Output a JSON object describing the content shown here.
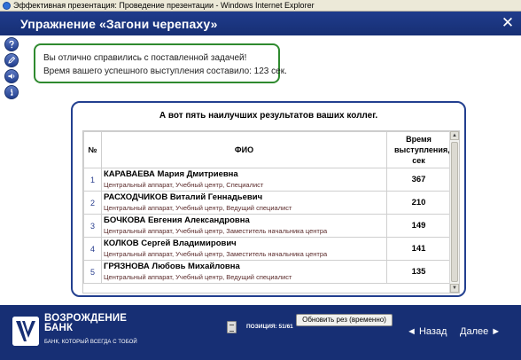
{
  "window": {
    "title": "Эффективная презентация: Проведение презентации - Windows Internet Explorer"
  },
  "header": {
    "title": "Упражнение «Загони черепаху»",
    "close_label": "✕"
  },
  "toolbar": {
    "icons": [
      "help-icon",
      "edit-icon",
      "audio-icon",
      "info-icon"
    ]
  },
  "message": {
    "line1": "Вы отлично справились с поставленной задачей!",
    "line2": "Время вашего успешного выступления составило: 123 сек."
  },
  "results": {
    "title": "А вот пять наилучших результатов ваших коллег.",
    "columns": {
      "num": "№",
      "name": "ФИО",
      "time": "Время выступления, сек"
    },
    "rows": [
      {
        "num": "1",
        "name": "КАРАВАЕВА Мария Дмитриевна",
        "dept": "Центральный аппарат, Учебный центр, Специалист",
        "time": "367"
      },
      {
        "num": "2",
        "name": "РАСХОДЧИКОВ Виталий Геннадьевич",
        "dept": "Центральный аппарат, Учебный центр, Ведущий специалист",
        "time": "210"
      },
      {
        "num": "3",
        "name": "БОЧКОВА Евгения Александровна",
        "dept": "Центральный аппарат, Учебный центр, Заместитель начальника центра",
        "time": "149"
      },
      {
        "num": "4",
        "name": "КОЛКОВ Сергей Владимирович",
        "dept": "Центральный аппарат, Учебный центр, Заместитель начальника центра",
        "time": "141"
      },
      {
        "num": "5",
        "name": "ГРЯЗНОВА Любовь Михайловна",
        "dept": "Центральный аппарат, Учебный центр, Ведущий специалист",
        "time": "135"
      }
    ]
  },
  "footer": {
    "logo_line1": "ВОЗРОЖДЕНИЕ",
    "logo_line2": "БАНК",
    "slogan": "БАНК, КОТОРЫЙ ВСЕГДА С ТОБОЙ",
    "position": "ПОЗИЦИЯ: 51/61",
    "refresh_label": "Обновить рез (временно)",
    "back_label": "◄ Назад",
    "next_label": "Далее ►"
  },
  "colors": {
    "brand_blue": "#172f74",
    "header_blue": "#1f3c8c",
    "success_green": "#2f8a2f"
  }
}
